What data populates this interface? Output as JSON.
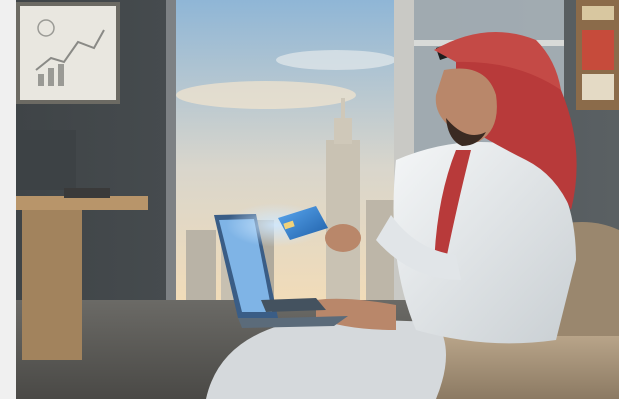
{
  "image": {
    "subject": "man-paying-online-with-card-and-laptop",
    "colors": {
      "frame_bg": "#f0f0f0",
      "wall_dark": "#4a4f52",
      "sky_top": "#8fb6d6",
      "sky_bottom": "#f2dcb8",
      "card_blue": "#2f7fd1",
      "shemagh_red": "#b83a3a",
      "thobe_white": "#e9ecee",
      "sofa": "#a8957c",
      "desk_wood": "#b8956a"
    },
    "icons": [
      "whiteboard-chart-icon",
      "credit-card-icon",
      "laptop-icon"
    ]
  }
}
